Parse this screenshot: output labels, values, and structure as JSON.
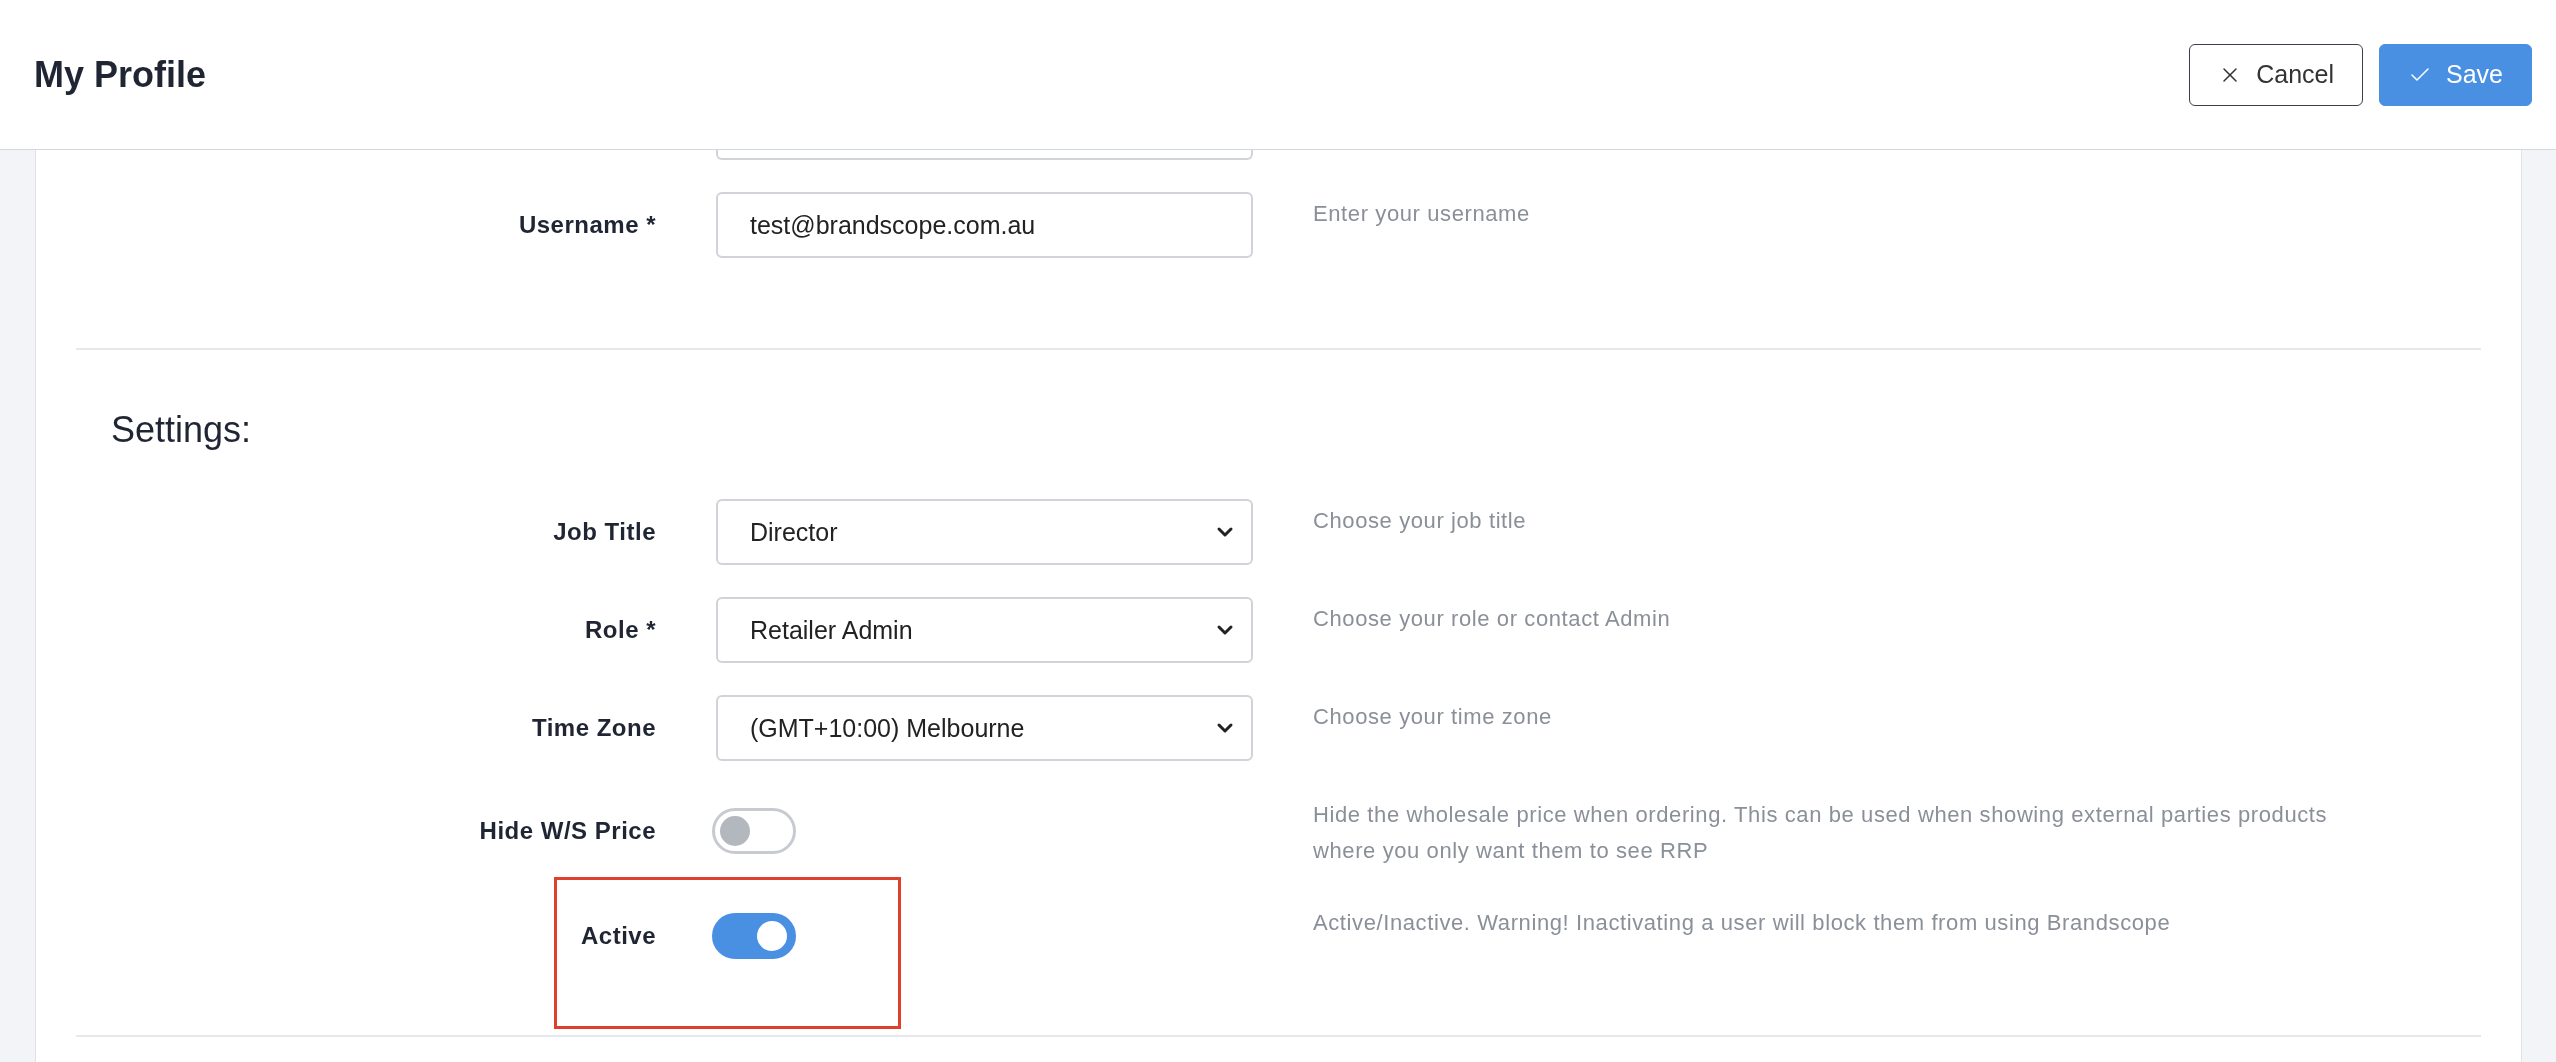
{
  "header": {
    "title": "My Profile",
    "buttons": [
      {
        "label": "Cancel",
        "kind": "cancel"
      },
      {
        "label": "Save",
        "kind": "save"
      }
    ]
  },
  "account_fields": [
    {
      "label": "Username *",
      "kind": "text",
      "value": "test@brandscope.com.au",
      "hint": "Enter your username"
    }
  ],
  "settings": {
    "heading": "Settings:",
    "fields": [
      {
        "label": "Job Title",
        "kind": "select",
        "value": "Director",
        "hint": "Choose your job title"
      },
      {
        "label": "Role *",
        "kind": "select",
        "value": "Retailer Admin",
        "hint": "Choose your role or contact Admin"
      },
      {
        "label": "Time Zone",
        "kind": "select",
        "value": "(GMT+10:00) Melbourne",
        "hint": "Choose your time zone"
      },
      {
        "label": "Hide W/S Price",
        "kind": "toggle",
        "on": false,
        "highlighted": false,
        "hint": "Hide the wholesale price when ordering. This can be used when showing external parties products where you only want them to see RRP"
      },
      {
        "label": "Active",
        "kind": "toggle",
        "on": true,
        "highlighted": true,
        "hint": "Active/Inactive. Warning! Inactivating a user will block them from using Brandscope"
      }
    ]
  }
}
